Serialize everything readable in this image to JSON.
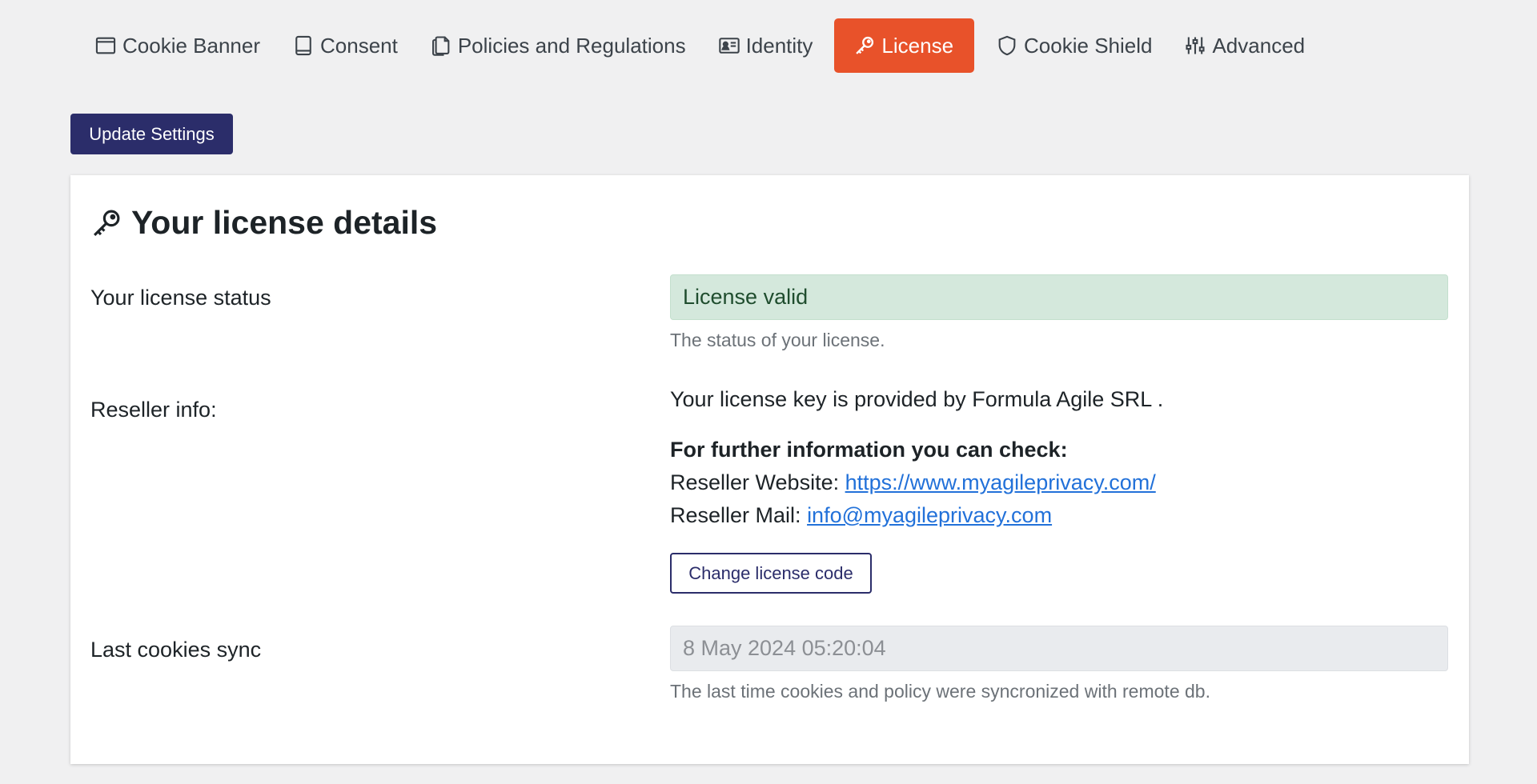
{
  "tabs": [
    {
      "label": "Cookie Banner",
      "icon": "window-icon"
    },
    {
      "label": "Consent",
      "icon": "tablet-icon"
    },
    {
      "label": "Policies and Regulations",
      "icon": "documents-icon"
    },
    {
      "label": "Identity",
      "icon": "id-card-icon"
    },
    {
      "label": "License",
      "icon": "key-icon",
      "active": true
    },
    {
      "label": "Cookie Shield",
      "icon": "shield-icon"
    },
    {
      "label": "Advanced",
      "icon": "sliders-icon"
    }
  ],
  "toolbar": {
    "update_label": "Update Settings"
  },
  "panel": {
    "title": "Your license details",
    "status": {
      "label": "Your license status",
      "value": "License valid",
      "help": "The status of your license."
    },
    "reseller": {
      "label": "Reseller info:",
      "provided_by": "Your license key is provided by Formula Agile SRL .",
      "further_info": "For further information you can check:",
      "website_label": "Reseller Website:",
      "website_url": "https://www.myagileprivacy.com/",
      "mail_label": "Reseller Mail:",
      "mail": "info@myagileprivacy.com",
      "change_button": "Change license code"
    },
    "sync": {
      "label": "Last cookies sync",
      "value": "8 May 2024 05:20:04",
      "help": "The last time cookies and policy were syncronized with remote db."
    }
  },
  "colors": {
    "active_tab": "#e8522a",
    "primary_button": "#2b2d6a",
    "valid_bg": "#d4e8dc",
    "link": "#2271d9"
  }
}
